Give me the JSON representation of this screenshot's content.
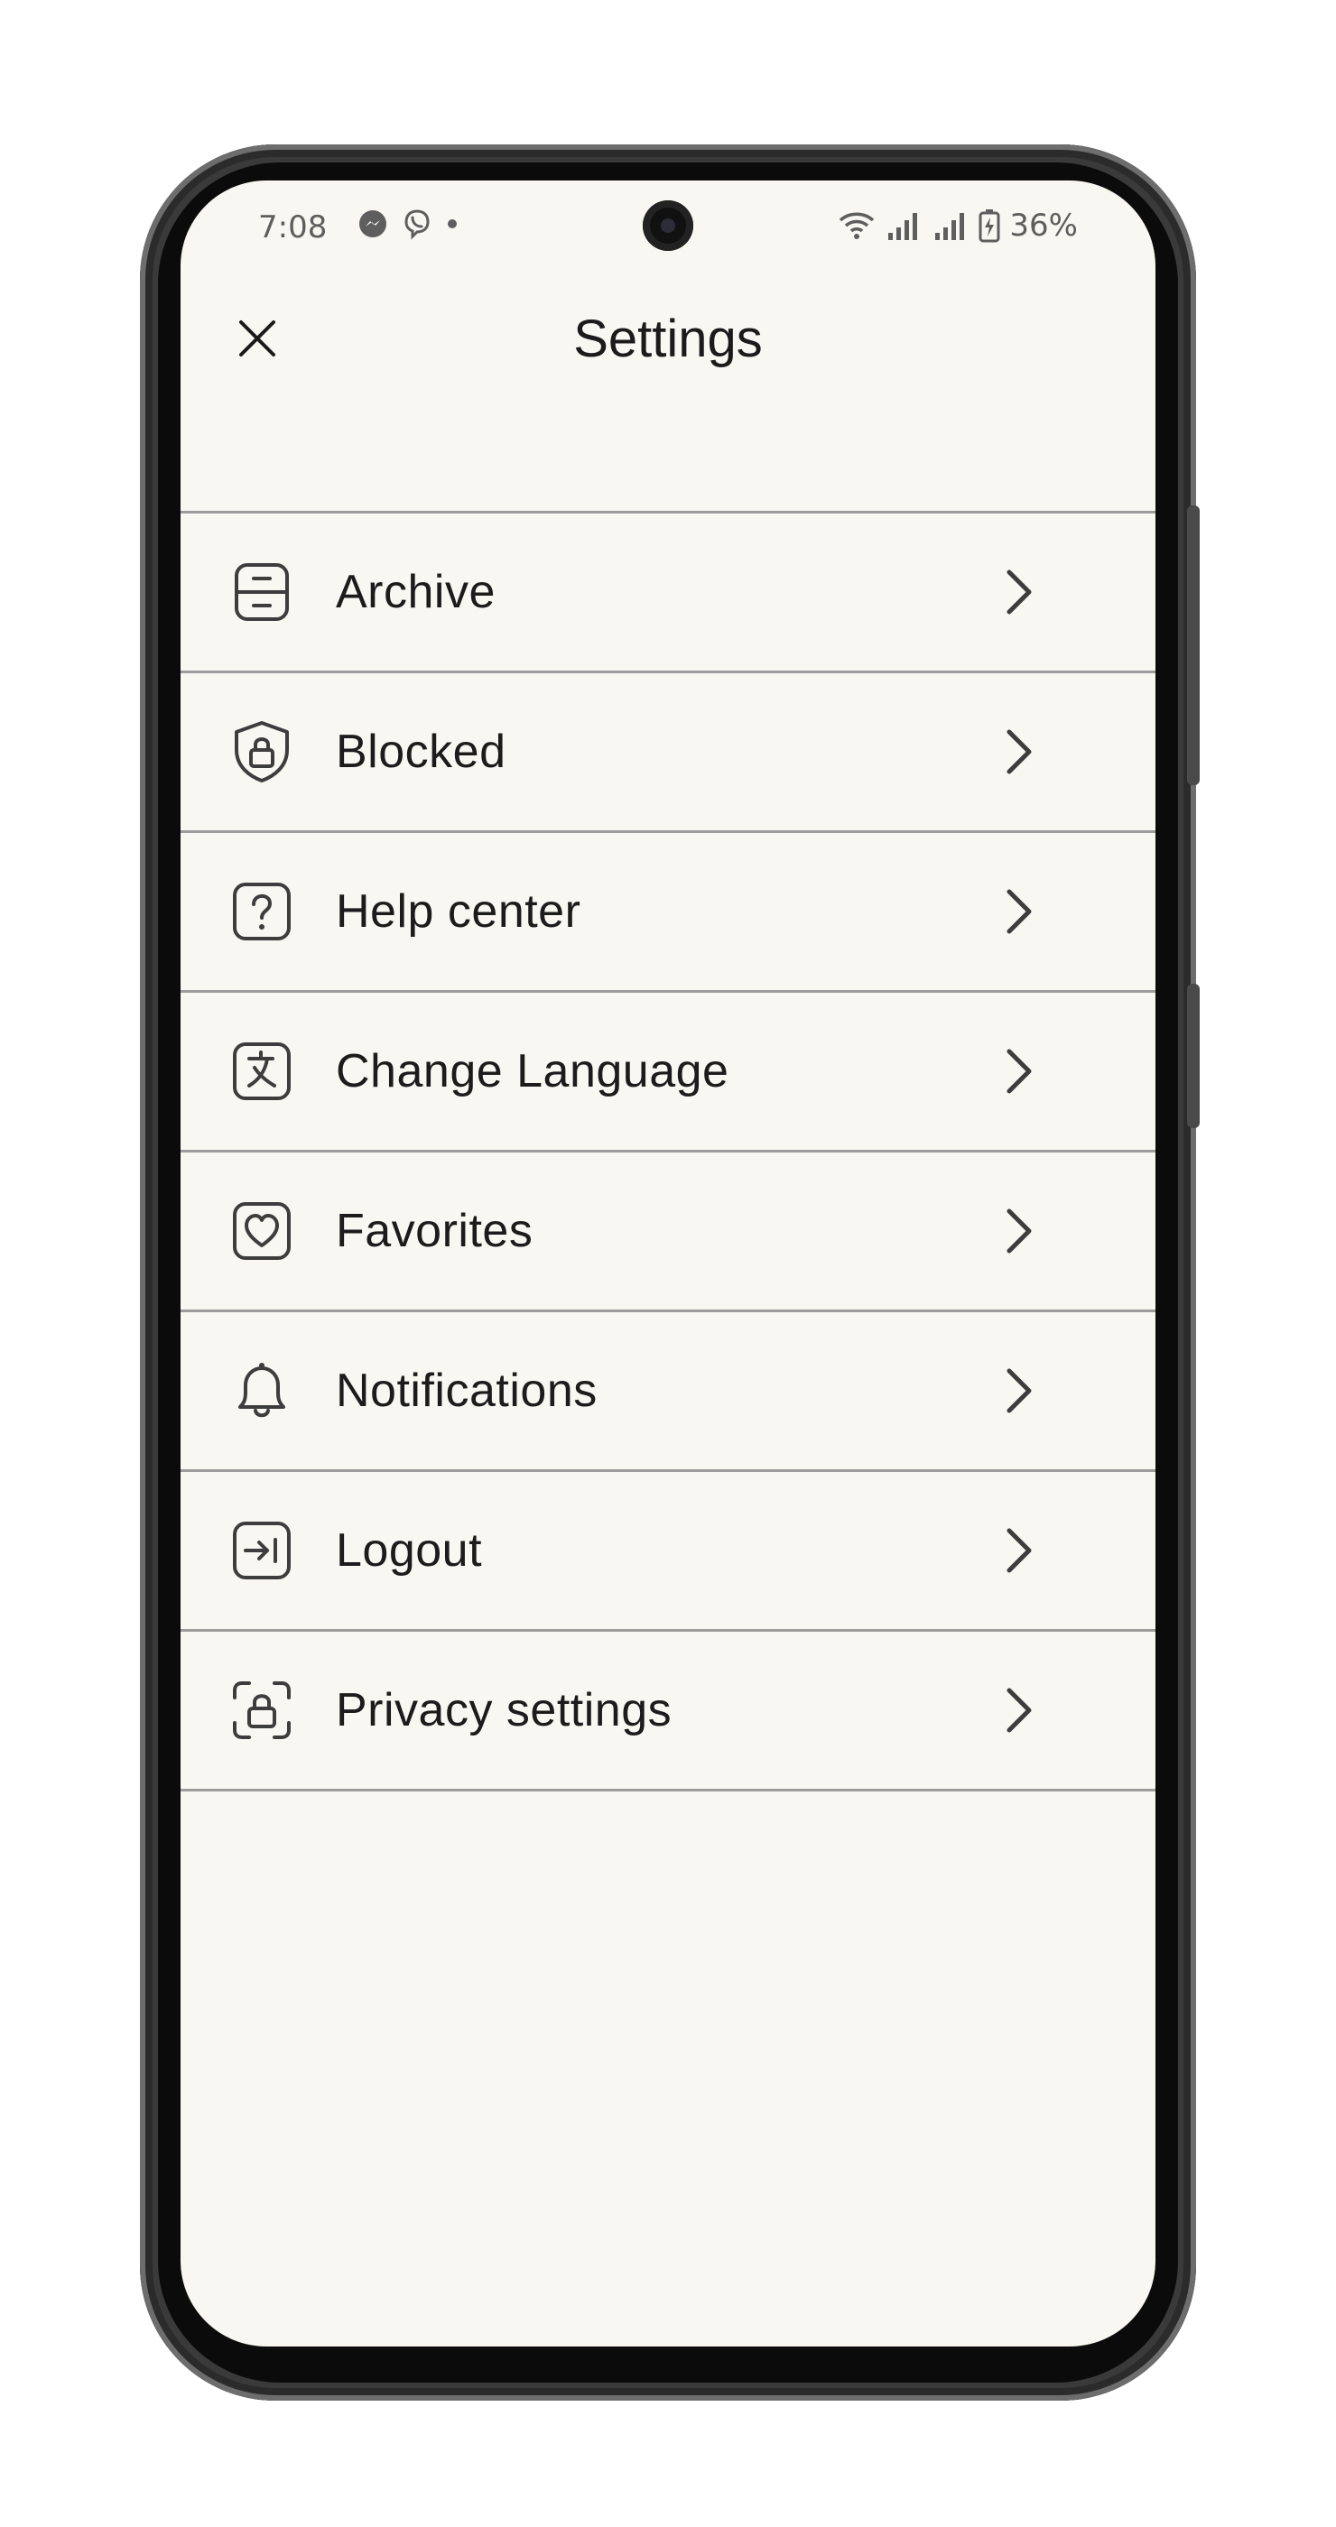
{
  "status_bar": {
    "time": "7:08",
    "battery": "36%",
    "icons": [
      "messenger-icon",
      "viber-icon",
      "dot-icon",
      "wifi-icon",
      "signal-icon",
      "signal-icon",
      "battery-charging-icon"
    ]
  },
  "header": {
    "title": "Settings",
    "close_icon": "close-icon"
  },
  "menu": {
    "items": [
      {
        "label": "Archive",
        "icon": "archive-icon"
      },
      {
        "label": "Blocked",
        "icon": "shield-lock-icon"
      },
      {
        "label": "Help center",
        "icon": "help-icon"
      },
      {
        "label": "Change Language",
        "icon": "translate-icon"
      },
      {
        "label": "Favorites",
        "icon": "heart-icon"
      },
      {
        "label": "Notifications",
        "icon": "bell-icon"
      },
      {
        "label": "Logout",
        "icon": "logout-icon"
      },
      {
        "label": "Privacy settings",
        "icon": "privacy-lock-icon"
      }
    ],
    "chevron_icon": "chevron-right-icon"
  },
  "colors": {
    "background": "#f9f7f1",
    "text": "#1c1c1c",
    "divider": "#9c9c9c",
    "icon": "#3d3d3d"
  }
}
